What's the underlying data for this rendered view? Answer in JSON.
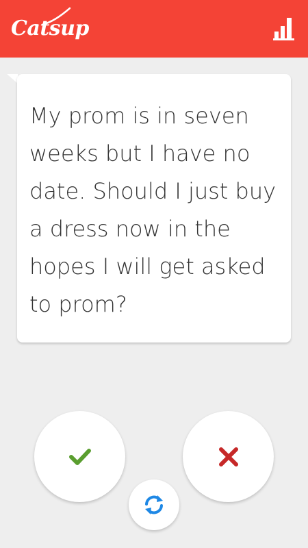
{
  "app": {
    "name": "Catsup",
    "header_color": "#f44336"
  },
  "header": {
    "stats_icon": "bar-chart-icon"
  },
  "card": {
    "question": "My prom is in seven weeks but I have no date. Should I just buy a dress now in the hopes I will get asked to prom?"
  },
  "actions": {
    "yes_icon": "check-icon",
    "yes_color": "#5a9e2f",
    "no_icon": "close-icon",
    "no_color": "#c62828",
    "refresh_icon": "refresh-icon",
    "refresh_color": "#1e88e5"
  }
}
